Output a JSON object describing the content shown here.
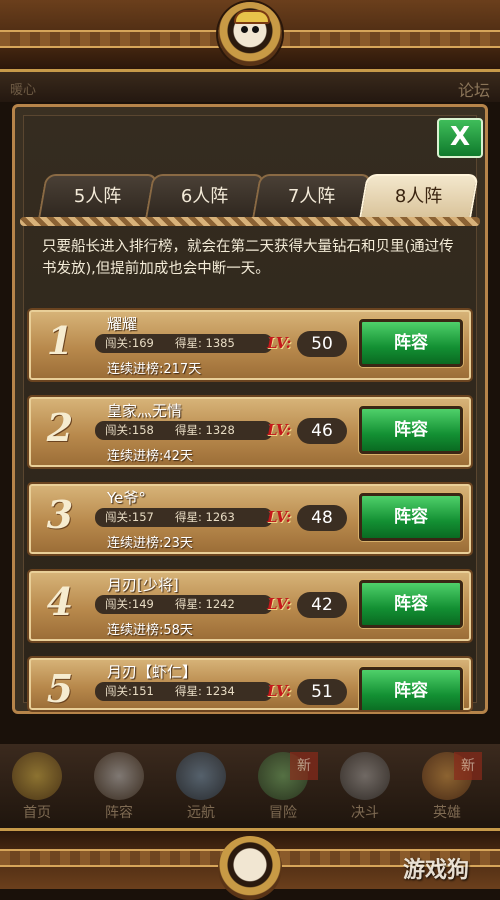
{
  "header": {
    "left_text": "暖心",
    "right_text": "论坛"
  },
  "close_label": "X",
  "tabs": [
    {
      "label": "5人阵",
      "active": false
    },
    {
      "label": "6人阵",
      "active": false
    },
    {
      "label": "7人阵",
      "active": false
    },
    {
      "label": "8人阵",
      "active": true
    }
  ],
  "notice": "只要船长进入排行榜，就会在第二天获得大量钻石和贝里(通过传书发放),但提前加成也会中断一天。",
  "labels": {
    "lv": "LV:",
    "lineup": "阵容"
  },
  "rankings": [
    {
      "rank": "1",
      "name": "耀耀",
      "stage": "闯关:169",
      "stars": "得星: 1385",
      "streak": "连续进榜:217天",
      "level": "50"
    },
    {
      "rank": "2",
      "name": "皇家灬无情",
      "stage": "闯关:158",
      "stars": "得星: 1328",
      "streak": "连续进榜:42天",
      "level": "46"
    },
    {
      "rank": "3",
      "name": "Ye爷°",
      "stage": "闯关:157",
      "stars": "得星: 1263",
      "streak": "连续进榜:23天",
      "level": "48"
    },
    {
      "rank": "4",
      "name": "月刃[少将]",
      "stage": "闯关:149",
      "stars": "得星: 1242",
      "streak": "连续进榜:58天",
      "level": "42"
    },
    {
      "rank": "5",
      "name": "月刃【虾仁】",
      "stage": "闯关:151",
      "stars": "得星: 1234",
      "streak": "",
      "level": "51"
    }
  ],
  "nav": [
    {
      "label": "首页",
      "icon": "home-icon",
      "badge": ""
    },
    {
      "label": "阵容",
      "icon": "lineup-icon",
      "badge": ""
    },
    {
      "label": "远航",
      "icon": "anchor-icon",
      "badge": ""
    },
    {
      "label": "冒险",
      "icon": "adventure-icon",
      "badge": "新"
    },
    {
      "label": "决斗",
      "icon": "duel-icon",
      "badge": ""
    },
    {
      "label": "英雄",
      "icon": "hero-icon",
      "badge": "新"
    }
  ],
  "watermark": "游戏狗"
}
